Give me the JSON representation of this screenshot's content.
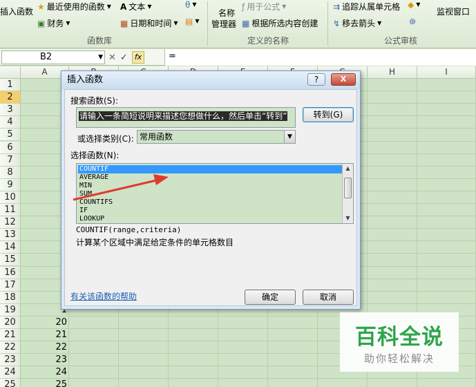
{
  "ribbon": {
    "insert_function": "插入函数",
    "recently_used": "最近使用的函数",
    "financial": "财务",
    "text": "文本",
    "date_time": "日期和时间",
    "function_library_label": "函数库",
    "name_manager_line1": "名称",
    "name_manager_line2": "管理器",
    "use_in_formula": "用于公式",
    "create_from_selection": "根据所选内容创建",
    "defined_names_label": "定义的名称",
    "trace_precedents": "追踪从属单元格",
    "remove_arrows": "移去箭头",
    "formula_auditing_label": "公式审核",
    "watch_window": "监视窗口"
  },
  "formula_bar": {
    "name_box": "B2",
    "fx_label": "fx",
    "value": "="
  },
  "grid": {
    "columns": [
      "A",
      "B",
      "C",
      "D",
      "E",
      "F",
      "G",
      "H",
      "I"
    ],
    "rows": [
      "1",
      "2",
      "3",
      "4",
      "5",
      "6",
      "7",
      "8",
      "9",
      "10",
      "11",
      "12",
      "13",
      "14",
      "15",
      "16",
      "17",
      "18",
      "19",
      "20",
      "21",
      "22",
      "23",
      "24",
      "25"
    ],
    "col_a_values": [
      "",
      "",
      "",
      "",
      "",
      "",
      "",
      "",
      "",
      "1",
      "1",
      "1",
      "1",
      "1",
      "1",
      "1",
      "1",
      "1",
      "1",
      "20",
      "21",
      "22",
      "23",
      "24",
      "25"
    ]
  },
  "dialog": {
    "title": "插入函数",
    "help_btn": "?",
    "close_btn": "X",
    "search_label": "搜索函数(S):",
    "search_text": "请输入一条简短说明来描述您想做什么，然后单击“转到”",
    "go_button": "转到(G)",
    "category_label": "或选择类别(C):",
    "category_value": "常用函数",
    "select_label": "选择函数(N):",
    "functions": [
      "COUNTIF",
      "AVERAGE",
      "MIN",
      "SUM",
      "COUNTIFS",
      "IF",
      "LOOKUP"
    ],
    "syntax": "COUNTIF(range,criteria)",
    "description": "计算某个区域中满足给定条件的单元格数目",
    "help_link": "有关该函数的帮助",
    "ok_button": "确定",
    "cancel_button": "取消"
  },
  "watermark": {
    "title": "百科全说",
    "subtitle": "助你轻松解决"
  },
  "colors": {
    "selection": "#3399ff",
    "arrow": "#e03a2f",
    "watermark_green": "#2ea54a"
  }
}
